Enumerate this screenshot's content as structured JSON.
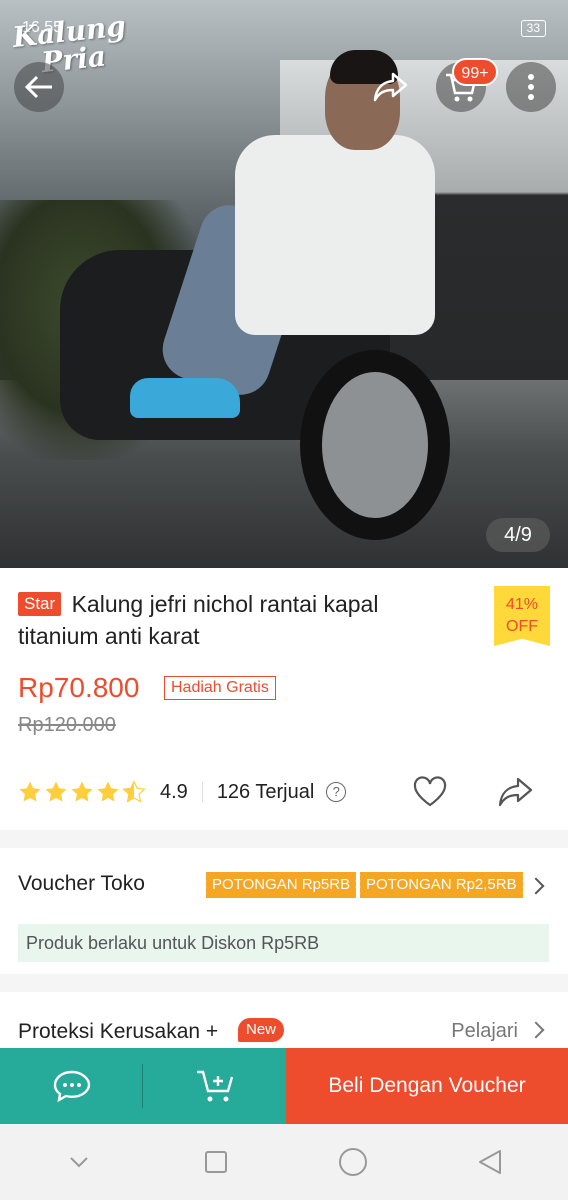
{
  "status_bar": {
    "time": "16.55",
    "battery": "33"
  },
  "watermark": {
    "line1": "Kalung",
    "line2": "Pria"
  },
  "header": {
    "cart_badge": "99+"
  },
  "gallery": {
    "counter": "4/9"
  },
  "product": {
    "star_tag": "Star",
    "title": "Kalung jefri nichol rantai kapal titanium anti karat",
    "discount_percent": "41%",
    "discount_label": "OFF",
    "price": "Rp70.800",
    "gift_tag": "Hadiah Gratis",
    "original_price": "Rp120.000",
    "rating": "4.9",
    "rating_stars": 4.5,
    "sold": "126 Terjual"
  },
  "voucher": {
    "title": "Voucher Toko",
    "chips": [
      "POTONGAN Rp5RB",
      "POTONGAN Rp2,5RB"
    ],
    "note": "Produk berlaku untuk Diskon Rp5RB"
  },
  "protection": {
    "title": "Proteksi Kerusakan +",
    "new_tag": "New",
    "learn_label": "Pelajari"
  },
  "actions": {
    "buy_label": "Beli Dengan Voucher"
  },
  "colors": {
    "accent": "#ee4d2d",
    "teal": "#26aa99",
    "star": "#ffce3d",
    "voucher_chip": "#f5a623"
  }
}
